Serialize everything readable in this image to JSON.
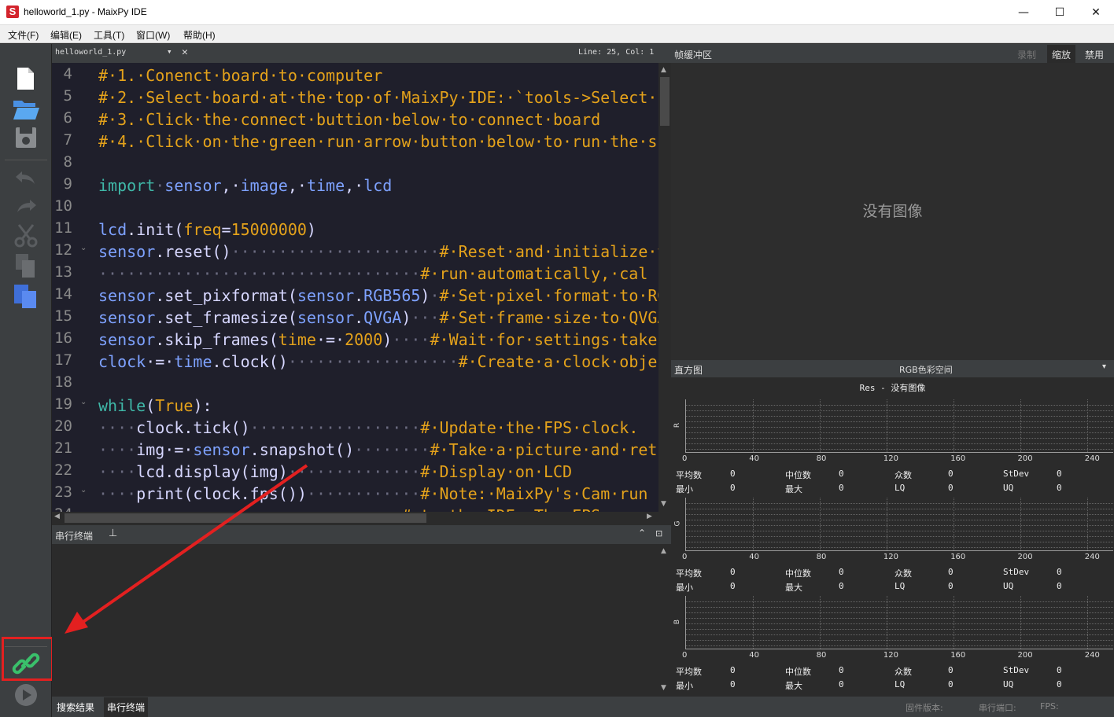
{
  "window": {
    "title": "helloworld_1.py - MaixPy IDE",
    "app_icon_letter": "S",
    "minimize": "—",
    "maximize": "☐",
    "close": "✕"
  },
  "menu": [
    "文件(F)",
    "编辑(E)",
    "工具(T)",
    "窗口(W)",
    "帮助(H)"
  ],
  "editor": {
    "tab_name": "helloworld_1.py",
    "dropdown_glyph": "▾",
    "close_glyph": "✕",
    "cursor_info": "Line: 25, Col: 1",
    "line_numbers": [
      "4",
      "5",
      "6",
      "7",
      "8",
      "9",
      "10",
      "11",
      "12",
      "13",
      "14",
      "15",
      "16",
      "17",
      "18",
      "19",
      "20",
      "21",
      "22",
      "23"
    ],
    "fold_lines": [
      "12",
      "19",
      "23"
    ],
    "last_partial_line": "24"
  },
  "serial_terminal": {
    "title": "串行终端"
  },
  "bottom_tabs": [
    "搜索结果",
    "串行终端"
  ],
  "status": {
    "firmware_label": "固件版本:",
    "port_label": "串行端口:",
    "fps_label": "FPS:"
  },
  "framebuffer": {
    "title": "帧缓冲区",
    "record": "录制",
    "zoom": "缩放",
    "disable": "禁用",
    "no_image": "没有图像"
  },
  "histogram": {
    "title": "直方图",
    "colorspace": "RGB色彩空间",
    "res_label": "Res - 没有图像",
    "x_ticks": [
      "0",
      "40",
      "80",
      "120",
      "160",
      "200",
      "240"
    ],
    "channels": [
      {
        "name": "R",
        "mean": "0",
        "median": "0",
        "mode": "0",
        "stdev": "0",
        "min": "0",
        "max": "0",
        "lq": "0",
        "uq": "0"
      },
      {
        "name": "G",
        "mean": "0",
        "median": "0",
        "mode": "0",
        "stdev": "0",
        "min": "0",
        "max": "0",
        "lq": "0",
        "uq": "0"
      },
      {
        "name": "B",
        "mean": "0",
        "median": "0",
        "mode": "0",
        "stdev": "0",
        "min": "0",
        "max": "0",
        "lq": "0",
        "uq": "0"
      }
    ],
    "stat_labels": {
      "mean": "平均数",
      "median": "中位数",
      "mode": "众数",
      "stdev": "StDev",
      "min": "最小",
      "max": "最大",
      "lq": "LQ",
      "uq": "UQ"
    }
  },
  "colors": {
    "accent_connect": "#3ac06b",
    "annotation_red": "#e32020",
    "comment": "#e4a21b",
    "keyword": "#3fb8a8"
  }
}
